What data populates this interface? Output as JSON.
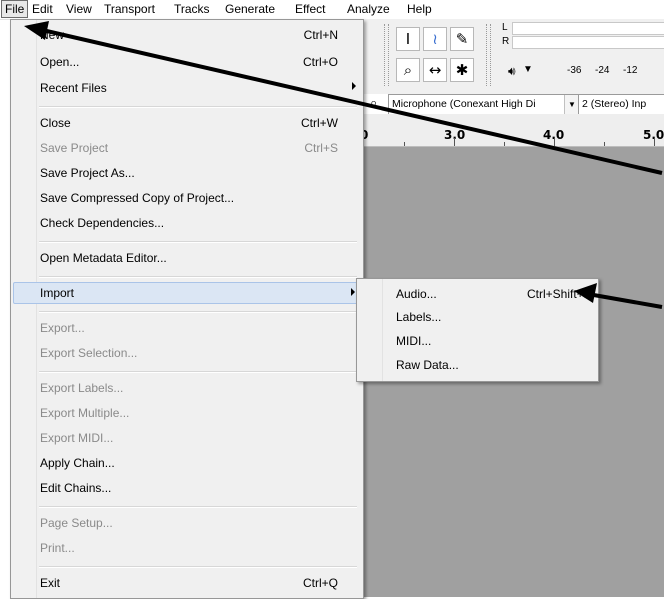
{
  "menubar": {
    "items": [
      "File",
      "Edit",
      "View",
      "Transport",
      "Tracks",
      "Generate",
      "Effect",
      "Analyze",
      "Help"
    ]
  },
  "toolbar": {
    "tools": [
      "selection-tool",
      "envelope-tool",
      "draw-tool",
      "zoom-tool",
      "timeshift-tool",
      "multi-tool"
    ],
    "meter_l": "L",
    "meter_r": "R",
    "playback_scale": [
      "-36",
      "-24",
      "-12"
    ],
    "input_device": "Microphone (Conexant High Di",
    "channels": "2 (Stereo) Inp"
  },
  "ruler": {
    "labels": [
      "0",
      "3.0",
      "4.0",
      "5.0"
    ]
  },
  "file_menu": {
    "items": [
      {
        "label": "New",
        "shortcut": "Ctrl+N",
        "enabled": true
      },
      {
        "label": "Open...",
        "shortcut": "Ctrl+O",
        "enabled": true
      },
      {
        "label": "Recent Files",
        "shortcut": "",
        "enabled": true,
        "submenu": true
      },
      {
        "label": "Close",
        "shortcut": "Ctrl+W",
        "enabled": true
      },
      {
        "label": "Save Project",
        "shortcut": "Ctrl+S",
        "enabled": false
      },
      {
        "label": "Save Project As...",
        "shortcut": "",
        "enabled": true
      },
      {
        "label": "Save Compressed Copy of Project...",
        "shortcut": "",
        "enabled": true
      },
      {
        "label": "Check Dependencies...",
        "shortcut": "",
        "enabled": true
      },
      {
        "label": "Open Metadata Editor...",
        "shortcut": "",
        "enabled": true
      },
      {
        "label": "Import",
        "shortcut": "",
        "enabled": true,
        "submenu": true,
        "highlighted": true
      },
      {
        "label": "Export...",
        "shortcut": "",
        "enabled": false
      },
      {
        "label": "Export Selection...",
        "shortcut": "",
        "enabled": false
      },
      {
        "label": "Export Labels...",
        "shortcut": "",
        "enabled": false
      },
      {
        "label": "Export Multiple...",
        "shortcut": "",
        "enabled": false
      },
      {
        "label": "Export MIDI...",
        "shortcut": "",
        "enabled": false
      },
      {
        "label": "Apply Chain...",
        "shortcut": "",
        "enabled": true
      },
      {
        "label": "Edit Chains...",
        "shortcut": "",
        "enabled": true
      },
      {
        "label": "Page Setup...",
        "shortcut": "",
        "enabled": false
      },
      {
        "label": "Print...",
        "shortcut": "",
        "enabled": false
      },
      {
        "label": "Exit",
        "shortcut": "Ctrl+Q",
        "enabled": true
      }
    ]
  },
  "import_submenu": {
    "items": [
      {
        "label": "Audio...",
        "shortcut": "Ctrl+Shift+I"
      },
      {
        "label": "Labels...",
        "shortcut": ""
      },
      {
        "label": "MIDI...",
        "shortcut": ""
      },
      {
        "label": "Raw Data...",
        "shortcut": ""
      }
    ]
  },
  "colors": {
    "menu_bg": "#f0f0f0",
    "highlight": "#dbe6f4",
    "disabled_text": "#8a8a8a",
    "track_area": "#a0a0a0",
    "annotation_arrow": "#000000"
  }
}
